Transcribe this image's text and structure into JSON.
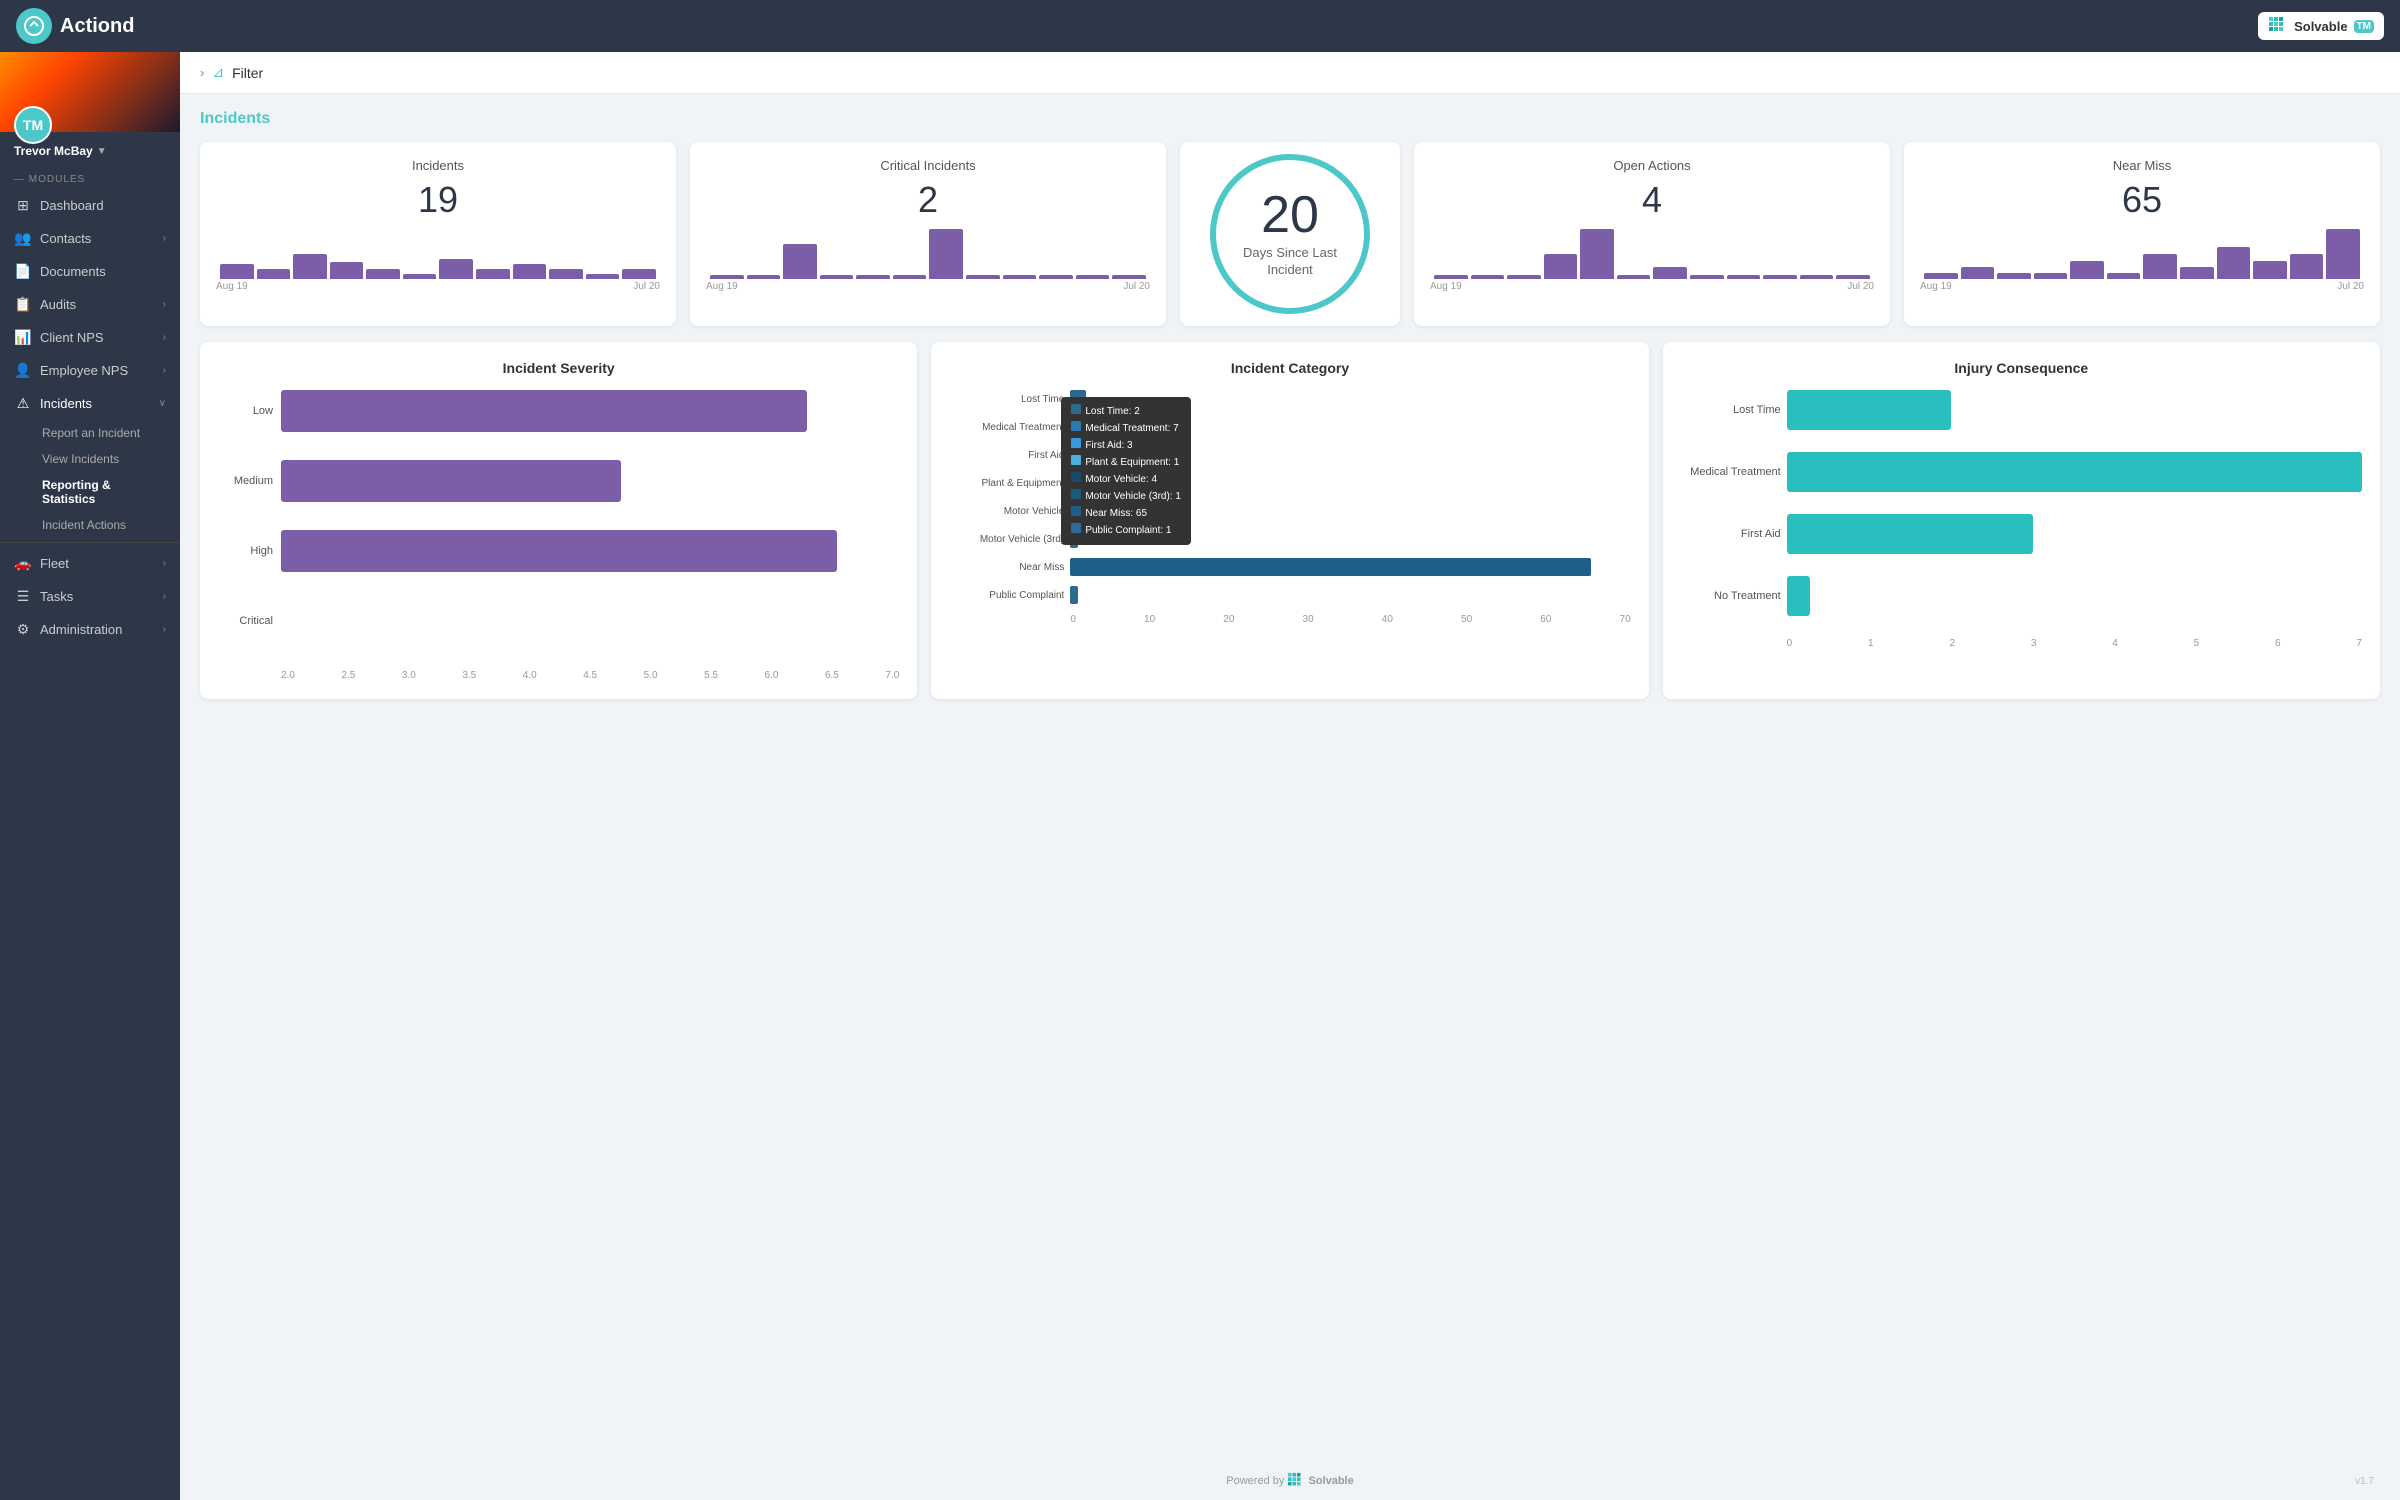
{
  "app": {
    "name": "Actiond",
    "hamburger": "☰",
    "solvable_label": "Solvable",
    "tm_badge": "TM",
    "version": "v1.7"
  },
  "user": {
    "initials": "TM",
    "name": "Trevor McBay",
    "caret": "▼"
  },
  "sidebar": {
    "modules_label": "— MODULES",
    "items": [
      {
        "id": "dashboard",
        "icon": "⊞",
        "label": "Dashboard",
        "has_arrow": false
      },
      {
        "id": "contacts",
        "icon": "👥",
        "label": "Contacts",
        "has_arrow": true
      },
      {
        "id": "documents",
        "icon": "📄",
        "label": "Documents",
        "has_arrow": false
      },
      {
        "id": "audits",
        "icon": "📋",
        "label": "Audits",
        "has_arrow": true
      },
      {
        "id": "client-nps",
        "icon": "📊",
        "label": "Client NPS",
        "has_arrow": true
      },
      {
        "id": "employee-nps",
        "icon": "👤",
        "label": "Employee NPS",
        "has_arrow": true
      },
      {
        "id": "incidents",
        "icon": "⚠",
        "label": "Incidents",
        "has_arrow": true,
        "active": true
      }
    ],
    "incidents_sub": [
      {
        "id": "report",
        "label": "Report an Incident"
      },
      {
        "id": "view",
        "label": "View Incidents"
      },
      {
        "id": "reporting",
        "label": "Reporting & Statistics",
        "active": true
      },
      {
        "id": "actions",
        "label": "Incident Actions"
      }
    ],
    "items2": [
      {
        "id": "fleet",
        "icon": "🚗",
        "label": "Fleet",
        "has_arrow": true
      },
      {
        "id": "tasks",
        "icon": "☰",
        "label": "Tasks",
        "has_arrow": true
      },
      {
        "id": "administration",
        "icon": "⚙",
        "label": "Administration",
        "has_arrow": true
      }
    ]
  },
  "filter": {
    "toggle_icon": "›",
    "funnel_icon": "⊿",
    "label": "Filter"
  },
  "section_title": "Incidents",
  "stats": [
    {
      "id": "incidents",
      "title": "Incidents",
      "value": "19",
      "date_start": "Aug 19",
      "date_end": "Jul 20",
      "bars": [
        3,
        2,
        5,
        3,
        2,
        1,
        4,
        2,
        3,
        2,
        1,
        2
      ]
    },
    {
      "id": "critical",
      "title": "Critical Incidents",
      "value": "2",
      "date_start": "Aug 19",
      "date_end": "Jul 20",
      "bars": [
        0,
        0,
        3,
        0,
        0,
        0,
        4,
        0,
        0,
        0,
        0,
        0
      ]
    },
    {
      "id": "open-actions",
      "title": "Open Actions",
      "value": "4",
      "date_start": "Aug 19",
      "date_end": "Jul 20",
      "bars": [
        0,
        0,
        0,
        2,
        4,
        0,
        1,
        0,
        0,
        0,
        0,
        0
      ]
    },
    {
      "id": "near-miss",
      "title": "Near Miss",
      "value": "65",
      "date_start": "Aug 19",
      "date_end": "Jul 20",
      "bars": [
        1,
        2,
        1,
        1,
        3,
        1,
        4,
        2,
        5,
        3,
        4,
        6
      ]
    }
  ],
  "days_since": {
    "number": "20",
    "label": "Days Since Last\nIncident"
  },
  "severity_chart": {
    "title": "Incident Severity",
    "bars": [
      {
        "label": "Low",
        "value": 6.0,
        "max": 7.0,
        "color": "#7b5ea7"
      },
      {
        "label": "Medium",
        "value": 4.0,
        "max": 7.0,
        "color": "#7b5ea7"
      },
      {
        "label": "High",
        "value": 6.3,
        "max": 7.0,
        "color": "#7b5ea7"
      },
      {
        "label": "Critical",
        "value": 0,
        "max": 7.0,
        "color": "#7b5ea7"
      }
    ],
    "x_labels": [
      "2.0",
      "2.5",
      "3.0",
      "3.5",
      "4.0",
      "4.5",
      "5.0",
      "5.5",
      "6.0",
      "6.5",
      "7.0"
    ]
  },
  "category_chart": {
    "title": "Incident Category",
    "bars": [
      {
        "label": "Lost Time",
        "value": 2,
        "max": 70,
        "color": "#2d6a8c"
      },
      {
        "label": "Medical Treatment",
        "value": 7,
        "max": 70,
        "color": "#2d6a8c"
      },
      {
        "label": "First Aid",
        "value": 3,
        "max": 70,
        "color": "#2d6a8c"
      },
      {
        "label": "Plant & Equipment",
        "value": 1,
        "max": 70,
        "color": "#2d6a8c"
      },
      {
        "label": "Motor Vehicle",
        "value": 4,
        "max": 70,
        "color": "#2d6a8c"
      },
      {
        "label": "Motor Vehicle (3rd)",
        "value": 1,
        "max": 70,
        "color": "#2d6a8c"
      },
      {
        "label": "Near Miss",
        "value": 65,
        "max": 70,
        "color": "#1e5f8a"
      },
      {
        "label": "Public Complaint",
        "value": 1,
        "max": 70,
        "color": "#2d6a8c"
      }
    ],
    "x_labels": [
      "0",
      "10",
      "20",
      "30",
      "40",
      "50",
      "60",
      "70"
    ],
    "tooltip": {
      "items": [
        {
          "label": "Lost Time: 2",
          "color": "#2d6a8c"
        },
        {
          "label": "Medical Treatment: 7",
          "color": "#2a7ab0"
        },
        {
          "label": "First Aid: 3",
          "color": "#3a9ad9"
        },
        {
          "label": "Plant & Equipment: 1",
          "color": "#4ab0e0"
        },
        {
          "label": "Motor Vehicle: 4",
          "color": "#1a4a6a"
        },
        {
          "label": "Motor Vehicle (3rd): 1",
          "color": "#1a5a7a"
        },
        {
          "label": "Near Miss: 65",
          "color": "#1e5f8a"
        },
        {
          "label": "Public Complaint: 1",
          "color": "#2d6a9c"
        }
      ]
    }
  },
  "injury_chart": {
    "title": "Injury Consequence",
    "bars": [
      {
        "label": "Lost Time",
        "value": 2,
        "max": 7,
        "color": "#2abfbf"
      },
      {
        "label": "Medical Treatment",
        "value": 7,
        "max": 7,
        "color": "#2abfbf"
      },
      {
        "label": "First Aid",
        "value": 3,
        "max": 7,
        "color": "#2abfbf"
      },
      {
        "label": "No Treatment",
        "value": 0.3,
        "max": 7,
        "color": "#2abfbf"
      }
    ],
    "x_labels": [
      "0",
      "1",
      "2",
      "3",
      "4",
      "5",
      "6",
      "7"
    ]
  },
  "footer": {
    "powered_by": "Powered by",
    "solvable": "Solvable",
    "version": "v1.7"
  }
}
